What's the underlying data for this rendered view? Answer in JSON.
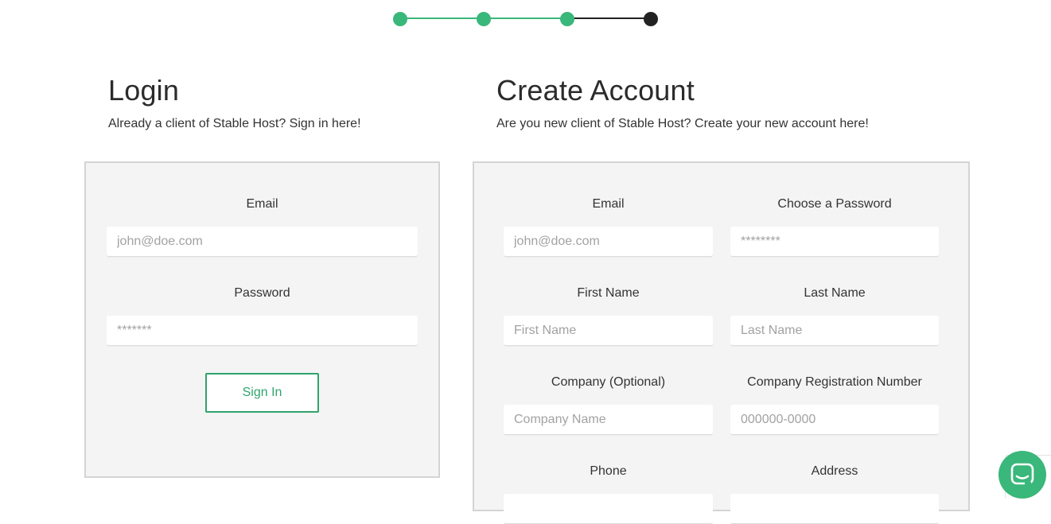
{
  "stepper": {
    "total_steps": 4,
    "completed_steps": 3,
    "colors": {
      "complete": "#3ab77a",
      "current": "#222222"
    }
  },
  "login": {
    "title": "Login",
    "subtitle": "Already a client of Stable Host? Sign in here!",
    "email_label": "Email",
    "email_placeholder": "john@doe.com",
    "password_label": "Password",
    "password_placeholder": "*******",
    "signin_label": "Sign In"
  },
  "create": {
    "title": "Create Account",
    "subtitle": "Are you new client of Stable Host? Create your new account here!",
    "email_label": "Email",
    "email_placeholder": "john@doe.com",
    "password_label": "Choose a Password",
    "password_placeholder": "********",
    "first_name_label": "First Name",
    "first_name_placeholder": "First Name",
    "last_name_label": "Last Name",
    "last_name_placeholder": "Last Name",
    "company_label": "Company (Optional)",
    "company_placeholder": "Company Name",
    "reg_label": "Company Registration Number",
    "reg_placeholder": "000000-0000",
    "phone_label": "Phone",
    "address_label": "Address"
  },
  "chat": {
    "icon": "chat-bubble-icon",
    "color": "#3ab77a"
  }
}
